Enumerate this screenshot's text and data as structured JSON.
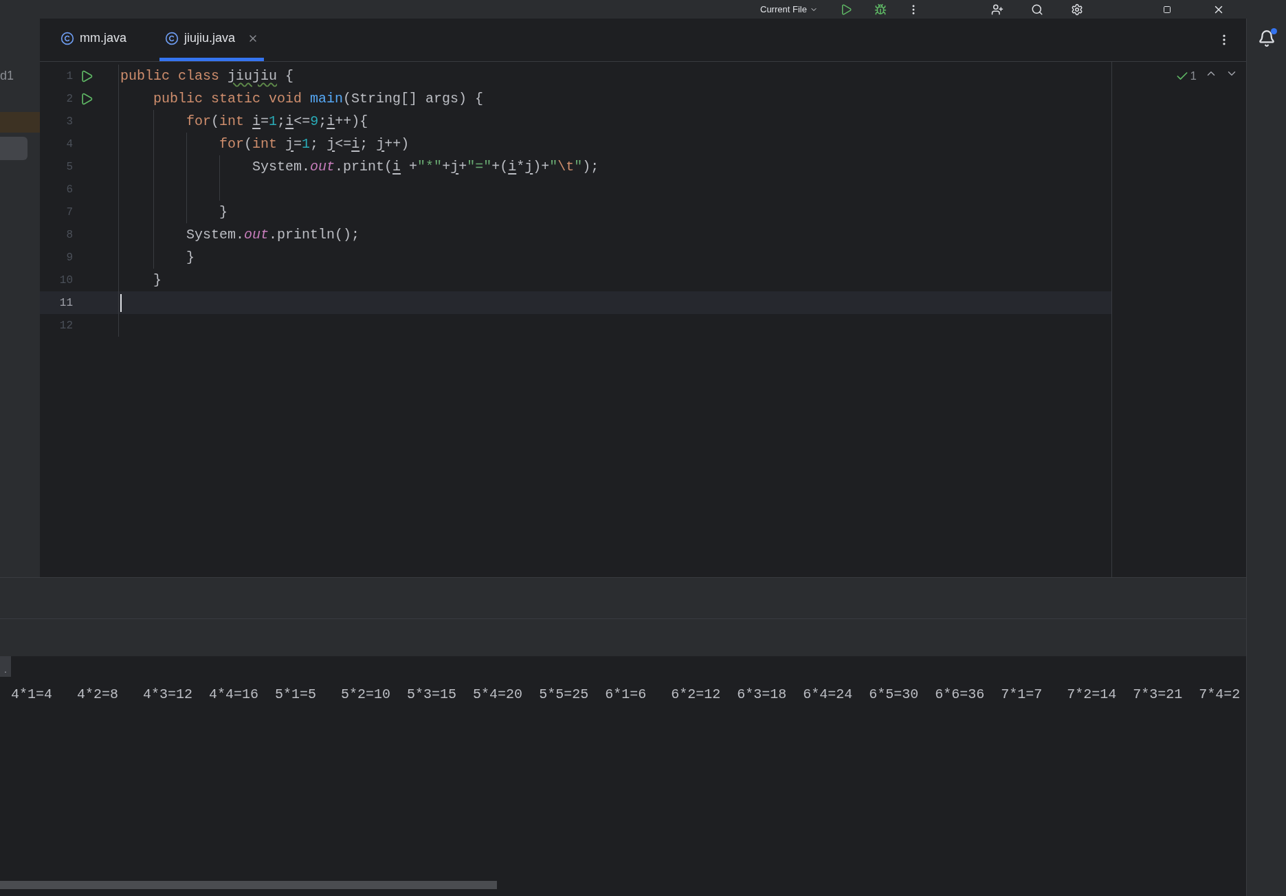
{
  "toolbar": {
    "run_config": "Current File"
  },
  "tabs": [
    {
      "label": "mm.java",
      "selected": false
    },
    {
      "label": "jiujiu.java",
      "selected": true
    }
  ],
  "side_label": "d1",
  "editor": {
    "lines": [
      {
        "number": "1",
        "runnable": true,
        "current": false,
        "tokens": [
          {
            "kind": "kw",
            "t": "public class "
          },
          {
            "kind": "warn",
            "t": "jiujiu"
          },
          {
            "kind": "plain",
            "t": " {"
          }
        ]
      },
      {
        "number": "2",
        "runnable": true,
        "current": false,
        "tokens": [
          {
            "kind": "kw",
            "t": "    public static void "
          },
          {
            "kind": "fn",
            "t": "main"
          },
          {
            "kind": "plain",
            "t": "(String[] args) {"
          }
        ]
      },
      {
        "number": "3",
        "runnable": false,
        "current": false,
        "tokens": [
          {
            "kind": "kw",
            "t": "        for"
          },
          {
            "kind": "plain",
            "t": "("
          },
          {
            "kind": "kw",
            "t": "int "
          },
          {
            "kind": "var",
            "t": "i"
          },
          {
            "kind": "plain",
            "t": "="
          },
          {
            "kind": "num",
            "t": "1"
          },
          {
            "kind": "plain",
            "t": ";"
          },
          {
            "kind": "var",
            "t": "i"
          },
          {
            "kind": "plain",
            "t": "<="
          },
          {
            "kind": "num",
            "t": "9"
          },
          {
            "kind": "plain",
            "t": ";"
          },
          {
            "kind": "var",
            "t": "i"
          },
          {
            "kind": "plain",
            "t": "++){"
          }
        ]
      },
      {
        "number": "4",
        "runnable": false,
        "current": false,
        "tokens": [
          {
            "kind": "kw",
            "t": "            for"
          },
          {
            "kind": "plain",
            "t": "("
          },
          {
            "kind": "kw",
            "t": "int "
          },
          {
            "kind": "var",
            "t": "j"
          },
          {
            "kind": "plain",
            "t": "="
          },
          {
            "kind": "num",
            "t": "1"
          },
          {
            "kind": "plain",
            "t": "; "
          },
          {
            "kind": "var",
            "t": "j"
          },
          {
            "kind": "plain",
            "t": "<="
          },
          {
            "kind": "var",
            "t": "i"
          },
          {
            "kind": "plain",
            "t": "; "
          },
          {
            "kind": "var",
            "t": "j"
          },
          {
            "kind": "plain",
            "t": "++)"
          }
        ]
      },
      {
        "number": "5",
        "runnable": false,
        "current": false,
        "tokens": [
          {
            "kind": "plain",
            "t": "                System."
          },
          {
            "kind": "field",
            "t": "out"
          },
          {
            "kind": "plain",
            "t": ".print("
          },
          {
            "kind": "var",
            "t": "i"
          },
          {
            "kind": "plain",
            "t": " +"
          },
          {
            "kind": "str",
            "t": "\"*\""
          },
          {
            "kind": "plain",
            "t": "+"
          },
          {
            "kind": "var",
            "t": "j"
          },
          {
            "kind": "plain",
            "t": "+"
          },
          {
            "kind": "str",
            "t": "\"=\""
          },
          {
            "kind": "plain",
            "t": "+("
          },
          {
            "kind": "var",
            "t": "i"
          },
          {
            "kind": "plain",
            "t": "*"
          },
          {
            "kind": "var",
            "t": "j"
          },
          {
            "kind": "plain",
            "t": ")+"
          },
          {
            "kind": "str",
            "t": "\""
          },
          {
            "kind": "esc",
            "t": "\\t"
          },
          {
            "kind": "str",
            "t": "\""
          },
          {
            "kind": "plain",
            "t": ");"
          }
        ]
      },
      {
        "number": "6",
        "runnable": false,
        "current": false
      },
      {
        "number": "7",
        "runnable": false,
        "current": false,
        "tokens": [
          {
            "kind": "plain",
            "t": "            }"
          }
        ]
      },
      {
        "number": "8",
        "runnable": false,
        "current": false,
        "tokens": [
          {
            "kind": "plain",
            "t": "        System."
          },
          {
            "kind": "field",
            "t": "out"
          },
          {
            "kind": "plain",
            "t": ".println();"
          }
        ]
      },
      {
        "number": "9",
        "runnable": false,
        "current": false,
        "tokens": [
          {
            "kind": "plain",
            "t": "        }"
          }
        ]
      },
      {
        "number": "10",
        "runnable": false,
        "current": false,
        "tokens": [
          {
            "kind": "plain",
            "t": "    }"
          }
        ]
      },
      {
        "number": "11",
        "runnable": false,
        "current": true
      },
      {
        "number": "12",
        "runnable": false,
        "current": false
      }
    ],
    "inspection_count": "1"
  },
  "console": {
    "marker": ".",
    "output": "4*1=4\t4*2=8\t4*3=12\t4*4=16\t5*1=5\t5*2=10\t5*3=15\t5*4=20\t5*5=25\t6*1=6\t6*2=12\t6*3=18\t6*4=24\t6*5=30\t6*6=36\t7*1=7\t7*2=14\t7*3=21\t7*4=2"
  },
  "notifications": {
    "unread": true
  }
}
